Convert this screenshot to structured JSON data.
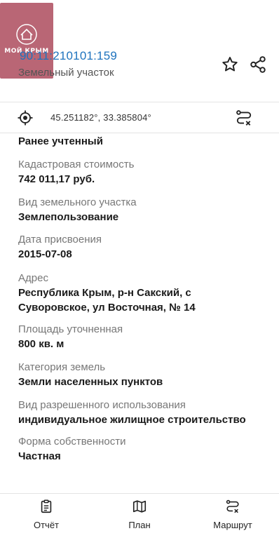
{
  "header": {
    "logo_text": "МОЙ КРЫМ",
    "cadastral_number": "90:11:210101:159",
    "subtitle": "Земельный участок"
  },
  "coords": {
    "value": "45.251182°, 33.385804°"
  },
  "details": {
    "status": "Ранее учтенный",
    "fields": [
      {
        "label": "Кадастровая стоимость",
        "value": "742 011,17 руб."
      },
      {
        "label": "Вид земельного участка",
        "value": "Землепользование"
      },
      {
        "label": "Дата присвоения",
        "value": "2015-07-08"
      },
      {
        "label": "Адрес",
        "value": "Республика Крым, р-н Сакский, с Суворовское, ул Восточная, № 14"
      },
      {
        "label": "Площадь уточненная",
        "value": "800 кв. м"
      },
      {
        "label": "Категория земель",
        "value": "Земли населенных пунктов"
      },
      {
        "label": "Вид разрешенного использования",
        "value": "индивидуальное жилищное строительство"
      },
      {
        "label": "Форма собственности",
        "value": "Частная"
      }
    ]
  },
  "bottom_nav": {
    "items": [
      {
        "label": "Отчёт",
        "icon": "report-icon"
      },
      {
        "label": "План",
        "icon": "map-icon"
      },
      {
        "label": "Маршрут",
        "icon": "route-icon"
      }
    ]
  },
  "colors": {
    "accent": "#1e73be",
    "logo_bg": "#b45a6a"
  }
}
